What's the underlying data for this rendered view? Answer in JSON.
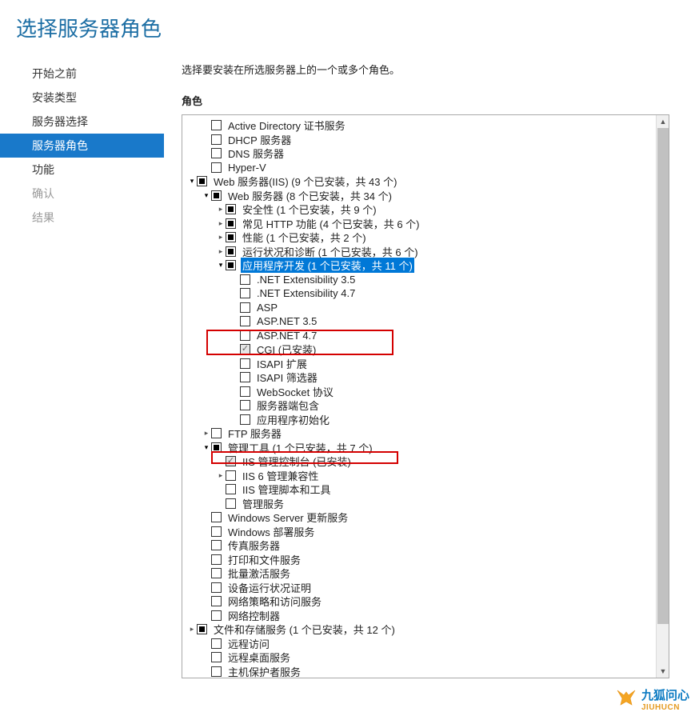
{
  "title": "选择服务器角色",
  "sidebar": {
    "items": [
      {
        "label": "开始之前",
        "state": "normal"
      },
      {
        "label": "安装类型",
        "state": "normal"
      },
      {
        "label": "服务器选择",
        "state": "normal"
      },
      {
        "label": "服务器角色",
        "state": "selected"
      },
      {
        "label": "功能",
        "state": "normal"
      },
      {
        "label": "确认",
        "state": "disabled"
      },
      {
        "label": "结果",
        "state": "disabled"
      }
    ]
  },
  "content": {
    "instruction": "选择要安装在所选服务器上的一个或多个角色。",
    "roles_label": "角色"
  },
  "tree": [
    {
      "indent": 1,
      "expander": "",
      "check": "empty",
      "label": "Active Directory 证书服务"
    },
    {
      "indent": 1,
      "expander": "",
      "check": "empty",
      "label": "DHCP 服务器"
    },
    {
      "indent": 1,
      "expander": "",
      "check": "empty",
      "label": "DNS 服务器"
    },
    {
      "indent": 1,
      "expander": "",
      "check": "empty",
      "label": "Hyper-V"
    },
    {
      "indent": 0,
      "expander": "open",
      "check": "partial",
      "label": "Web 服务器(IIS) (9 个已安装，共 43 个)"
    },
    {
      "indent": 1,
      "expander": "open",
      "check": "partial",
      "label": "Web 服务器 (8 个已安装，共 34 个)"
    },
    {
      "indent": 2,
      "expander": "closed",
      "check": "partial",
      "label": "安全性 (1 个已安装，共 9 个)"
    },
    {
      "indent": 2,
      "expander": "closed",
      "check": "partial",
      "label": "常见 HTTP 功能 (4 个已安装，共 6 个)"
    },
    {
      "indent": 2,
      "expander": "closed",
      "check": "partial",
      "label": "性能 (1 个已安装，共 2 个)"
    },
    {
      "indent": 2,
      "expander": "closed",
      "check": "partial",
      "label": "运行状况和诊断 (1 个已安装，共 6 个)"
    },
    {
      "indent": 2,
      "expander": "open",
      "check": "partial",
      "label": "应用程序开发 (1 个已安装，共 11 个)",
      "selected": true
    },
    {
      "indent": 3,
      "expander": "",
      "check": "empty",
      "label": ".NET Extensibility 3.5"
    },
    {
      "indent": 3,
      "expander": "",
      "check": "empty",
      "label": ".NET Extensibility 4.7"
    },
    {
      "indent": 3,
      "expander": "",
      "check": "empty",
      "label": "ASP"
    },
    {
      "indent": 3,
      "expander": "",
      "check": "empty",
      "label": "ASP.NET 3.5"
    },
    {
      "indent": 3,
      "expander": "",
      "check": "empty",
      "label": "ASP.NET 4.7"
    },
    {
      "indent": 3,
      "expander": "",
      "check": "checked-disabled",
      "label": "CGI (已安装)"
    },
    {
      "indent": 3,
      "expander": "",
      "check": "empty",
      "label": "ISAPI 扩展"
    },
    {
      "indent": 3,
      "expander": "",
      "check": "empty",
      "label": "ISAPI 筛选器"
    },
    {
      "indent": 3,
      "expander": "",
      "check": "empty",
      "label": "WebSocket 协议"
    },
    {
      "indent": 3,
      "expander": "",
      "check": "empty",
      "label": "服务器端包含"
    },
    {
      "indent": 3,
      "expander": "",
      "check": "empty",
      "label": "应用程序初始化"
    },
    {
      "indent": 1,
      "expander": "closed",
      "check": "empty",
      "label": "FTP 服务器"
    },
    {
      "indent": 1,
      "expander": "open",
      "check": "partial",
      "label": "管理工具 (1 个已安装，共 7 个)"
    },
    {
      "indent": 2,
      "expander": "",
      "check": "checked-disabled",
      "label": "IIS 管理控制台 (已安装)"
    },
    {
      "indent": 2,
      "expander": "closed",
      "check": "empty",
      "label": "IIS 6 管理兼容性"
    },
    {
      "indent": 2,
      "expander": "",
      "check": "empty",
      "label": "IIS 管理脚本和工具"
    },
    {
      "indent": 2,
      "expander": "",
      "check": "empty",
      "label": "管理服务"
    },
    {
      "indent": 1,
      "expander": "",
      "check": "empty",
      "label": "Windows Server 更新服务"
    },
    {
      "indent": 1,
      "expander": "",
      "check": "empty",
      "label": "Windows 部署服务"
    },
    {
      "indent": 1,
      "expander": "",
      "check": "empty",
      "label": "传真服务器"
    },
    {
      "indent": 1,
      "expander": "",
      "check": "empty",
      "label": "打印和文件服务"
    },
    {
      "indent": 1,
      "expander": "",
      "check": "empty",
      "label": "批量激活服务"
    },
    {
      "indent": 1,
      "expander": "",
      "check": "empty",
      "label": "设备运行状况证明"
    },
    {
      "indent": 1,
      "expander": "",
      "check": "empty",
      "label": "网络策略和访问服务"
    },
    {
      "indent": 1,
      "expander": "",
      "check": "empty",
      "label": "网络控制器"
    },
    {
      "indent": 0,
      "expander": "closed",
      "check": "partial",
      "label": "文件和存储服务 (1 个已安装，共 12 个)"
    },
    {
      "indent": 1,
      "expander": "",
      "check": "empty",
      "label": "远程访问"
    },
    {
      "indent": 1,
      "expander": "",
      "check": "empty",
      "label": "远程桌面服务"
    },
    {
      "indent": 1,
      "expander": "",
      "check": "empty",
      "label": "主机保护者服务"
    }
  ],
  "watermark": {
    "cn": "九狐问心",
    "en": "JIUHUCN"
  }
}
